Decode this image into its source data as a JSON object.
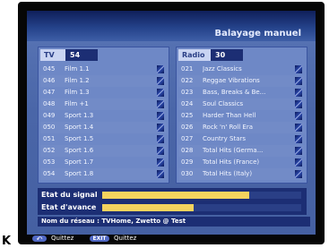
{
  "header": {
    "title": "Balayage manuel"
  },
  "tv": {
    "tab": "TV",
    "count": "54",
    "items": [
      {
        "num": "045",
        "name": "Film 1.1"
      },
      {
        "num": "046",
        "name": "Film 1.2"
      },
      {
        "num": "047",
        "name": "Film 1.3"
      },
      {
        "num": "048",
        "name": "Film +1"
      },
      {
        "num": "049",
        "name": "Sport 1.3"
      },
      {
        "num": "050",
        "name": "Sport 1.4"
      },
      {
        "num": "051",
        "name": "Sport 1.5"
      },
      {
        "num": "052",
        "name": "Sport 1.6"
      },
      {
        "num": "053",
        "name": "Sport 1.7"
      },
      {
        "num": "054",
        "name": "Sport 1.8"
      }
    ]
  },
  "radio": {
    "tab": "Radio",
    "count": "30",
    "items": [
      {
        "num": "021",
        "name": "Jazz Classics"
      },
      {
        "num": "022",
        "name": "Reggae Vibrations"
      },
      {
        "num": "023",
        "name": "Bass, Breaks & Be..."
      },
      {
        "num": "024",
        "name": "Soul Classics"
      },
      {
        "num": "025",
        "name": "Harder Than Hell"
      },
      {
        "num": "026",
        "name": "Rock 'n' Roll Era"
      },
      {
        "num": "027",
        "name": "Country Stars"
      },
      {
        "num": "028",
        "name": "Total Hits (Germa..."
      },
      {
        "num": "029",
        "name": "Total Hits (France)"
      },
      {
        "num": "030",
        "name": "Total Hits (Italy)"
      }
    ]
  },
  "signal": {
    "label": "Etat du signal",
    "level": 0.74,
    "color": "#f4d35e"
  },
  "progress": {
    "label": "Etat d'avance",
    "level": 0.46,
    "color": "#f4d35e"
  },
  "network": {
    "text": "Nom du réseau : TVHome, Zwetto @ Test"
  },
  "footer": {
    "back_key": "⤺",
    "back_hint": "Quittez",
    "exit_key": "EXIT",
    "exit_hint": "Quittez"
  },
  "outside_mark": "K"
}
